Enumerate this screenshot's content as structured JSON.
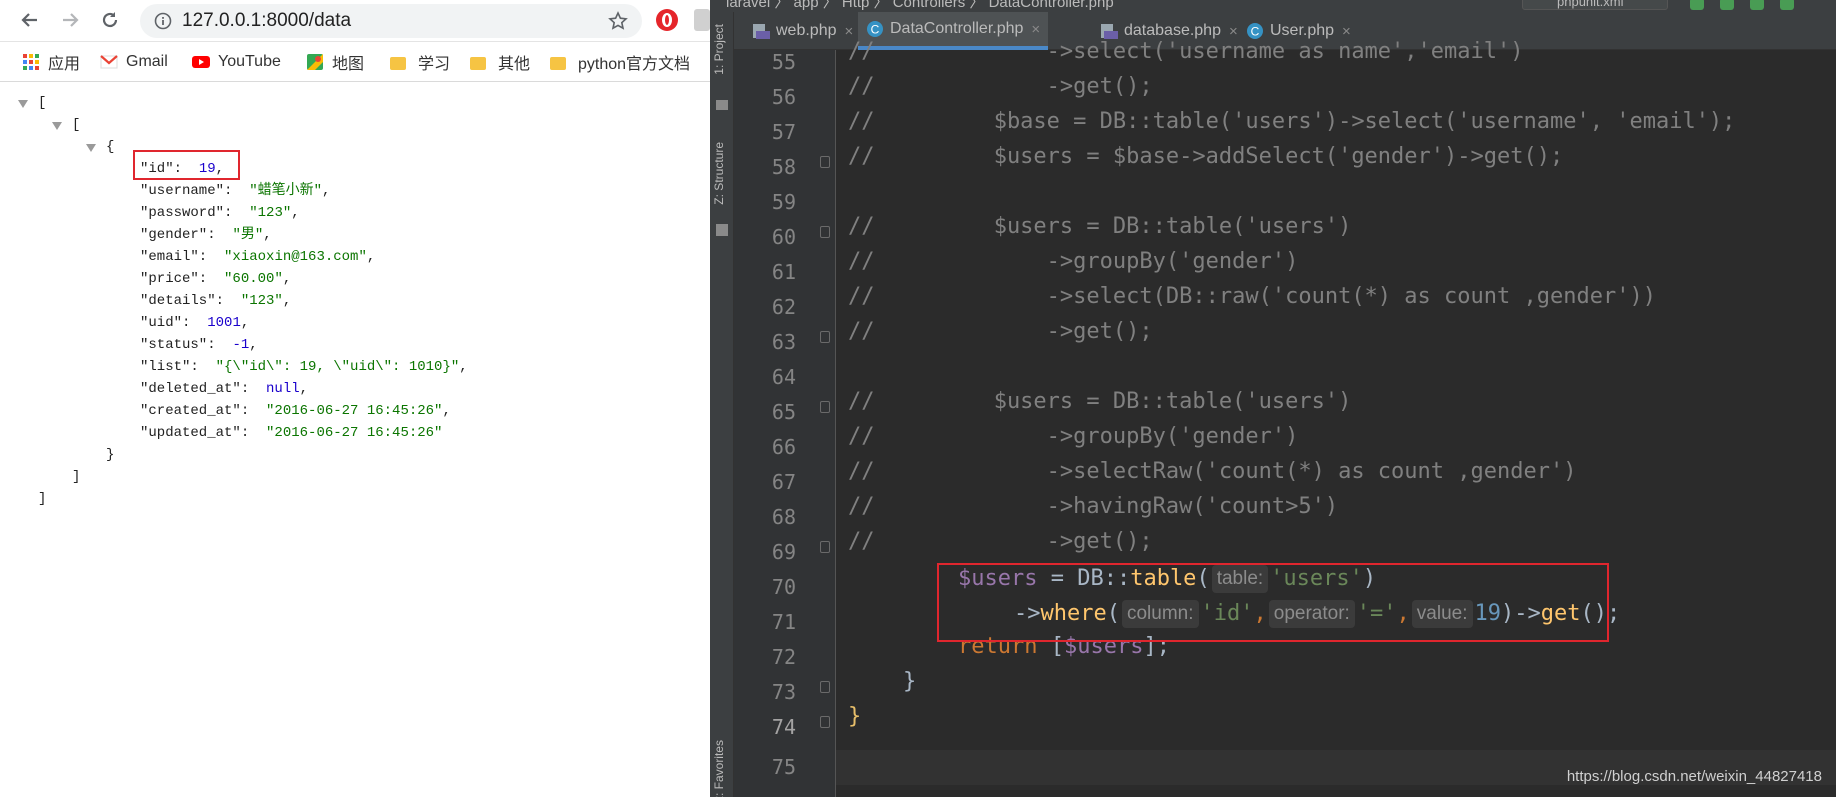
{
  "browser": {
    "url": "127.0.0.1:8000/data",
    "bookmarks": [
      "应用",
      "Gmail",
      "YouTube",
      "地图",
      "学习",
      "其他",
      "python官方文档"
    ],
    "json_lines": {
      "open_outer": "[",
      "open_inner": "[",
      "open_obj": "{",
      "id_key": "\"id\":",
      "id_val": "19",
      "username_key": "\"username\":",
      "username_val": "\"蜡笔小新\"",
      "password_key": "\"password\":",
      "password_val": "\"123\"",
      "gender_key": "\"gender\":",
      "gender_val": "\"男\"",
      "email_key": "\"email\":",
      "email_val": "\"xiaoxin@163.com\"",
      "price_key": "\"price\":",
      "price_val": "\"60.00\"",
      "details_key": "\"details\":",
      "details_val": "\"123\"",
      "uid_key": "\"uid\":",
      "uid_val": "1001",
      "status_key": "\"status\":",
      "status_val": "-1",
      "list_key": "\"list\":",
      "list_val": "\"{\\\"id\\\": 19, \\\"uid\\\": 1010}\"",
      "deleted_key": "\"deleted_at\":",
      "deleted_val": "null",
      "created_key": "\"created_at\":",
      "created_val": "\"2016-06-27 16:45:26\"",
      "updated_key": "\"updated_at\":",
      "updated_val": "\"2016-06-27 16:45:26\"",
      "close_obj": "}",
      "close_inner": "]",
      "close_outer": "]",
      "comma": ","
    }
  },
  "ide": {
    "nav_path": "laravel 〉 app 〉 Http 〉 Controllers 〉 DataController.php",
    "run_config": "phpunit.xml",
    "side_tabs": {
      "project": "1: Project",
      "structure": "Z: Structure",
      "favorites": "2: Favorites"
    },
    "tabs": [
      {
        "label": "web.php",
        "active": false
      },
      {
        "label": "DataController.php",
        "active": true
      },
      {
        "label": "database.php",
        "active": false
      },
      {
        "label": "User.php",
        "active": false
      }
    ],
    "tab_close": "×",
    "line_numbers": [
      "55",
      "56",
      "57",
      "58",
      "59",
      "60",
      "61",
      "62",
      "63",
      "64",
      "65",
      "66",
      "67",
      "68",
      "69",
      "70",
      "71",
      "72",
      "73",
      "74",
      "75"
    ],
    "code": {
      "l55": "//             ->select('username as name','email')",
      "l56": "//             ->get();",
      "l57": "//         $base = DB::table('users')->select('username', 'email');",
      "l58": "//         $users = $base->addSelect('gender')->get();",
      "l60": "//         $users = DB::table('users')",
      "l61": "//             ->groupBy('gender')",
      "l62": "//             ->select(DB::raw('count(*) as count ,gender'))",
      "l63": "//             ->get();",
      "l65": "//         $users = DB::table('users')",
      "l66": "//             ->groupBy('gender')",
      "l67": "//             ->selectRaw('count(*) as count ,gender')",
      "l68": "//             ->havingRaw('count>5')",
      "l69": "//             ->get();",
      "l70_var": "$users",
      "l70_eq": " = DB::",
      "l70_fn": "table",
      "l70_open": "(",
      "l70_hint": "table:",
      "l70_str": "'users'",
      "l70_close": ")",
      "l71_arrow": "->",
      "l71_fn": "where",
      "l71_open": "(",
      "l71_hint1": "column:",
      "l71_str1": "'id'",
      "l71_comma1": ",",
      "l71_hint2": "operator:",
      "l71_str2": "'='",
      "l71_comma2": ",",
      "l71_hint3": "value:",
      "l71_num": "19",
      "l71_close": ")->",
      "l71_get": "get",
      "l71_end": "();",
      "l72_kw": "return",
      "l72_open": " [",
      "l72_var": "$users",
      "l72_end": "];",
      "l73": "}",
      "l74": "}"
    },
    "colors": {
      "comment": "#808080",
      "variable": "#9876aa",
      "function": "#ffc66d",
      "string": "#6a8759",
      "number": "#6897bb",
      "keyword": "#cc7832",
      "highlight_box": "#e0262e"
    }
  },
  "watermark": "https://blog.csdn.net/weixin_44827418"
}
